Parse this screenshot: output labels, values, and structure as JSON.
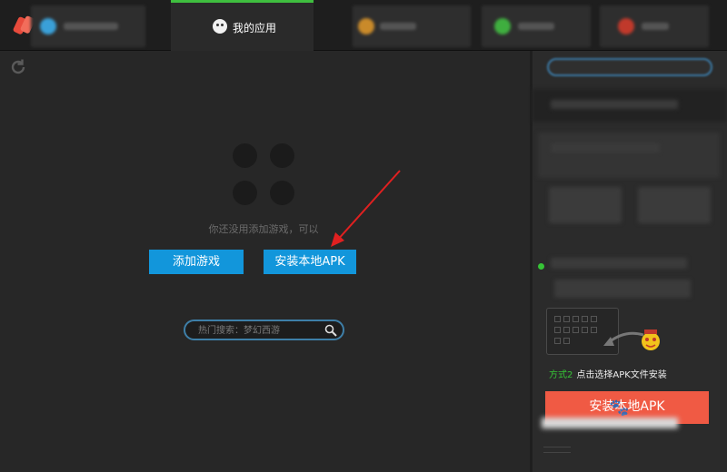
{
  "header": {
    "active_tab_label": "我的应用"
  },
  "main": {
    "empty_hint": "你还没用添加游戏，可以",
    "add_game_label": "添加游戏",
    "install_apk_label": "安装本地APK",
    "search": {
      "placeholder": "热门搜索：梦幻西游"
    }
  },
  "sidebar": {
    "method2_tag": "方式2",
    "method2_text": "点击选择APK文件安装",
    "install_button_label": "安装本地APK"
  },
  "colors": {
    "accent_green": "#3fbf3f",
    "button_blue": "#1296db",
    "install_red": "#f05a44",
    "annotation_arrow": "#e02020"
  }
}
